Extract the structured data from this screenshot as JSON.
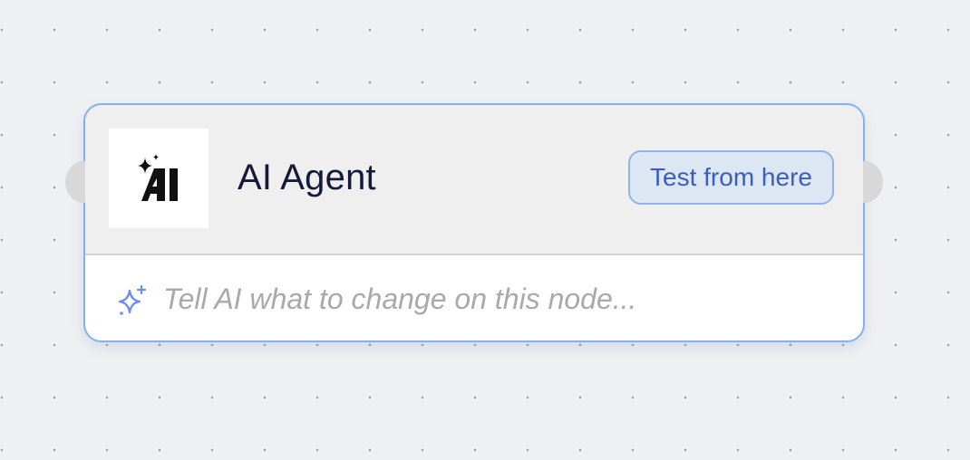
{
  "node": {
    "title": "AI Agent",
    "icon": "ai-agent-logo",
    "test_button_label": "Test from here",
    "prompt_placeholder": "Tell AI what to change on this node...",
    "prompt_value": ""
  },
  "colors": {
    "canvas_bg": "#eff0f2",
    "node_border": "#7fb0ef",
    "button_text": "#3c5dc0",
    "button_bg": "#dce7f3",
    "sparkle": "#6a8ff0"
  }
}
